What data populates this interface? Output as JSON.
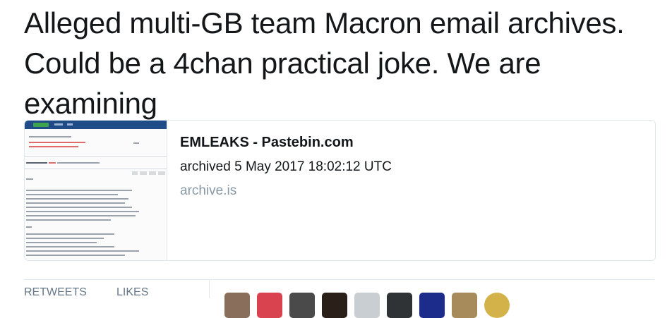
{
  "tweet": {
    "text": "Alleged multi-GB team Macron email archives. Could be a 4chan practical joke. We are examining"
  },
  "card": {
    "title": "EMLEAKS - Pastebin.com",
    "description": "archived 5 May 2017 18:02:12 UTC",
    "domain": "archive.is"
  },
  "stats": {
    "retweets_label": "RETWEETS",
    "likes_label": "LIKES"
  },
  "colors": {
    "text": "#14171a",
    "muted": "#657786",
    "domain": "#8899a6",
    "border": "#e1e8ed"
  },
  "avatars": [
    {
      "color": "#8a6e5c"
    },
    {
      "color": "#d8434f"
    },
    {
      "color": "#4a4a4a"
    },
    {
      "color": "#2b1f1a"
    },
    {
      "color": "#c9ced3"
    },
    {
      "color": "#2f3336"
    },
    {
      "color": "#1b2c8a"
    },
    {
      "color": "#a88b5a"
    },
    {
      "color": "#d4b24a"
    }
  ]
}
